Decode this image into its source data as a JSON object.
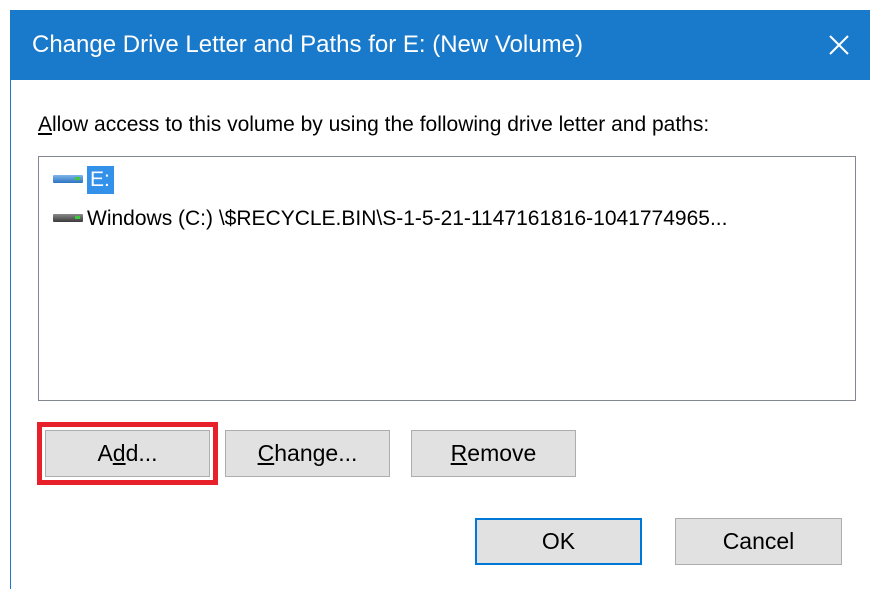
{
  "window": {
    "title": "Change Drive Letter and Paths for E: (New Volume)",
    "close_icon": "close-icon",
    "accent_color": "#1979ca"
  },
  "prompt": {
    "accesskey": "A",
    "rest": "llow access to this volume by using the following drive letter and paths:"
  },
  "list": {
    "items": [
      {
        "icon": "drive-icon",
        "label": "E:",
        "selected": true
      },
      {
        "icon": "drive-icon",
        "label": "Windows (C:) \\$RECYCLE.BIN\\S-1-5-21-1147161816-1041774965...",
        "selected": false
      }
    ],
    "selection_color": "#3391ea"
  },
  "buttons": {
    "add": {
      "pre": "A",
      "key": "d",
      "post": "d..."
    },
    "change": {
      "pre": "",
      "key": "C",
      "post": "hange..."
    },
    "remove": {
      "pre": "",
      "key": "R",
      "post": "emove"
    },
    "ok": "OK",
    "cancel": "Cancel"
  },
  "annotation": {
    "highlight_color": "#e8202a",
    "highlighted": "add-button"
  }
}
